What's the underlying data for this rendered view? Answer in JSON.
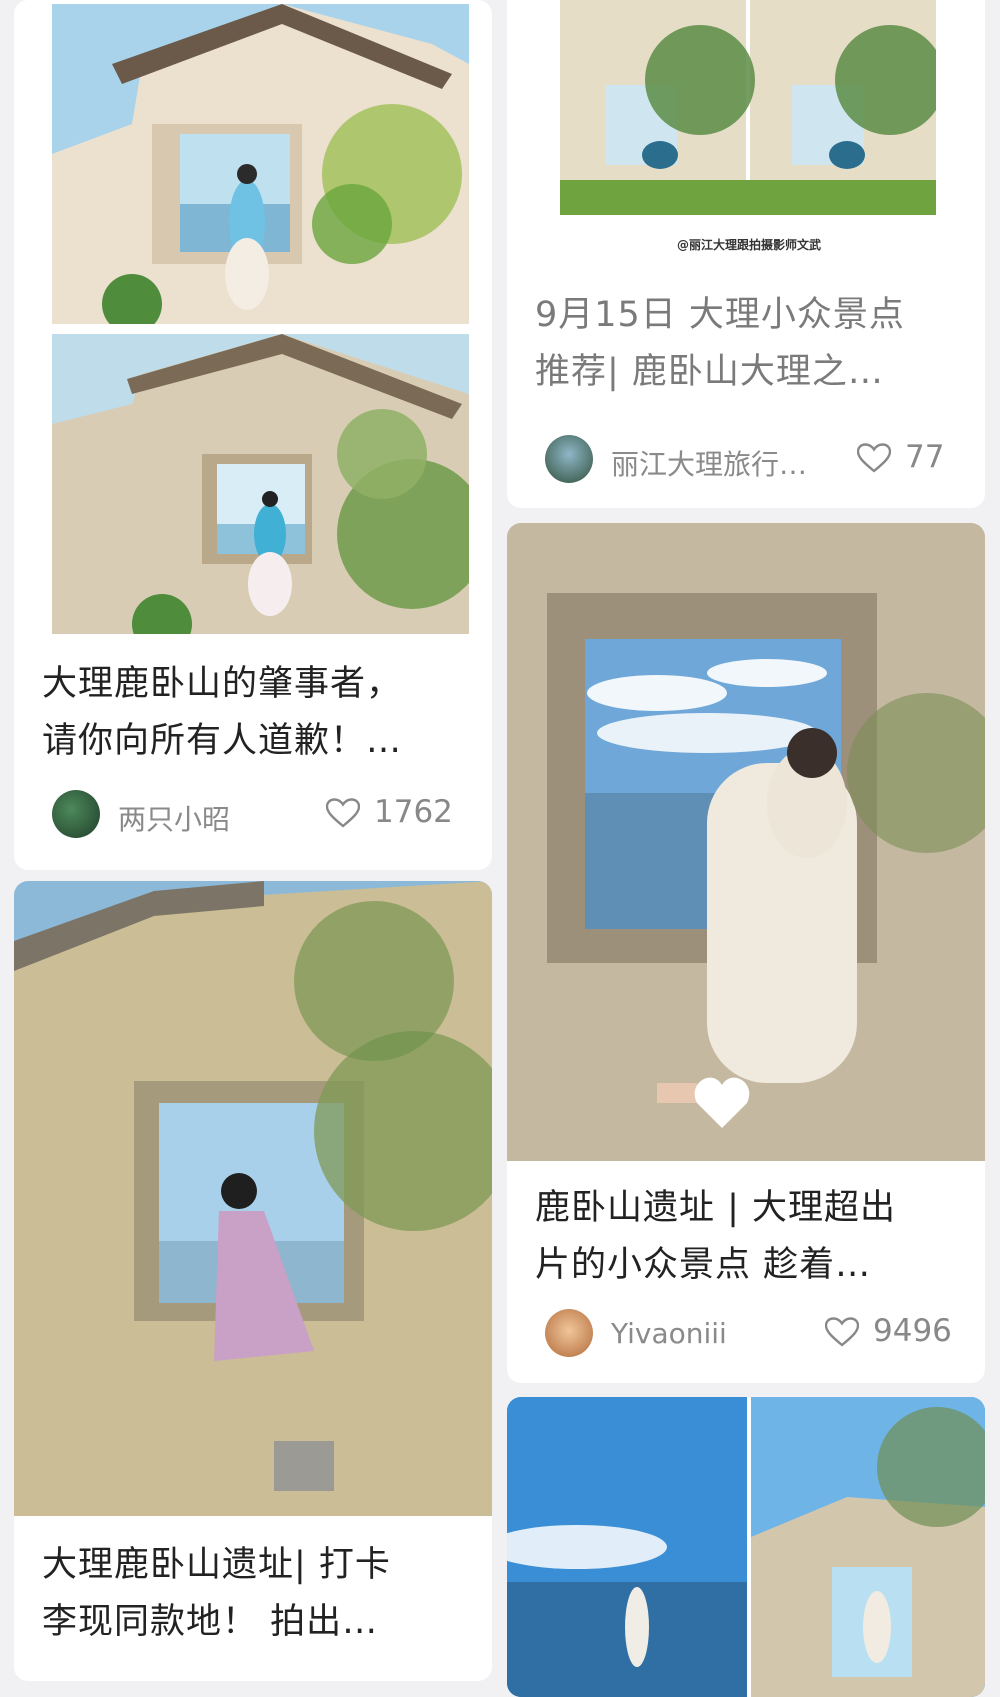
{
  "feed": {
    "cards": [
      {
        "title_line1": "大理鹿卧山的肇事者，",
        "title_line2": "请你向所有人道歉！…",
        "author": "两只小昭",
        "likes": "1762"
      },
      {
        "watermark": "@丽江大理跟拍摄影师文武",
        "title_line1": "9月15日 大理小众景点",
        "title_line2": "推荐| 鹿卧山大理之…",
        "author": "丽江大理旅行…",
        "likes": "77"
      },
      {
        "title_line1": "鹿卧山遗址 | 大理超出",
        "title_line2": "片的小众景点 趁着…",
        "author": "Yivaoniii",
        "likes": "9496"
      },
      {
        "title_line1": "大理鹿卧山遗址| 打卡",
        "title_line2": "李现同款地！ 拍出…"
      }
    ]
  },
  "icons": {
    "like": "heart-outline-icon"
  },
  "colors": {
    "background": "#f1f1f3",
    "card": "#ffffff",
    "title": "#222222",
    "meta": "#888888"
  }
}
